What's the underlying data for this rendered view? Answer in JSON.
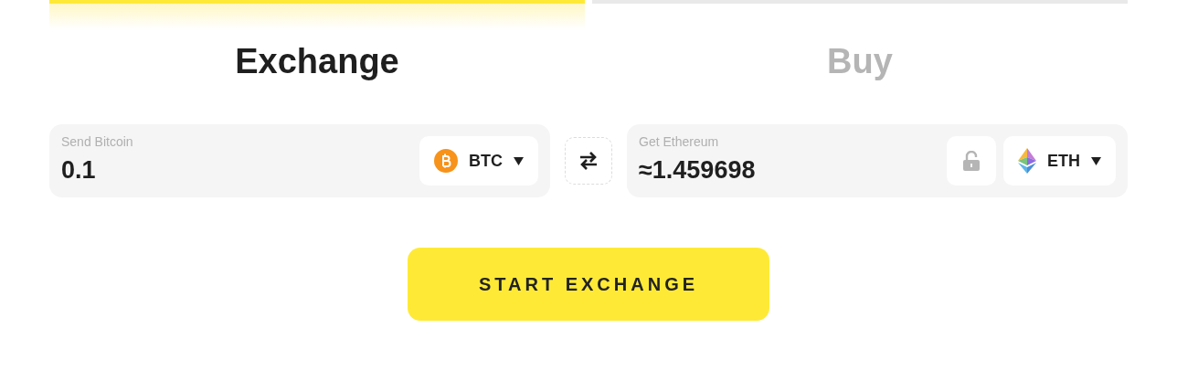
{
  "tabs": [
    {
      "label": "Exchange",
      "selected": true
    },
    {
      "label": "Buy",
      "selected": false
    }
  ],
  "send": {
    "label": "Send Bitcoin",
    "value": "0.1",
    "currency": {
      "kind": "bitcoin",
      "code": "BTC"
    }
  },
  "get": {
    "label": "Get Ethereum",
    "value": "≈1.459698",
    "locked": false,
    "currency": {
      "kind": "ethereum",
      "code": "ETH"
    }
  },
  "button": {
    "label": "START EXCHANGE"
  }
}
